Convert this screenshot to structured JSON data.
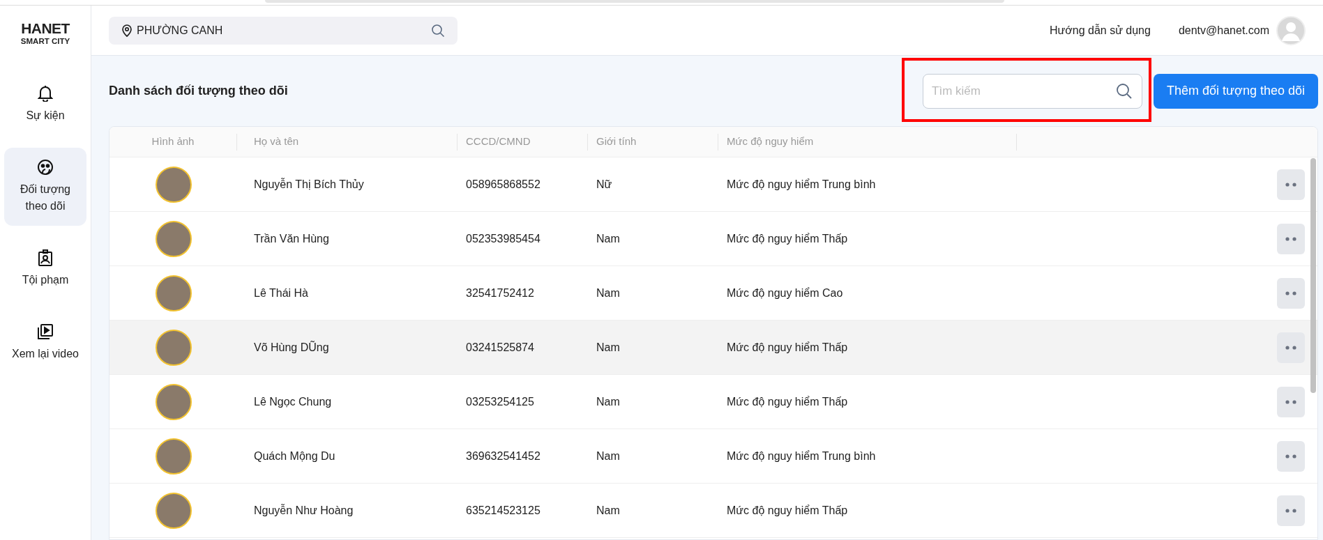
{
  "logo": {
    "brand": "HANET",
    "tagline": "SMART CITY"
  },
  "sidebar": {
    "items": [
      {
        "label": "Sự kiện",
        "selected": false
      },
      {
        "label": "Đối tượng theo dõi",
        "selected": true
      },
      {
        "label": "Tội phạm",
        "selected": false
      },
      {
        "label": "Xem lại video",
        "selected": false
      }
    ]
  },
  "header": {
    "location": "PHƯỜNG CANH",
    "help_link": "Hướng dẫn sử dụng",
    "user_email": "dentv@hanet.com"
  },
  "page": {
    "title": "Danh sách đối tượng theo dõi",
    "search": {
      "placeholder": "Tìm kiếm",
      "highlighted": true
    },
    "add_button": "Thêm đối tượng theo dõi"
  },
  "table": {
    "columns": [
      "Hình ảnh",
      "Họ và tên",
      "CCCD/CMND",
      "Giới tính",
      "Mức độ nguy hiểm"
    ],
    "rows": [
      {
        "name": "Nguyễn Thị Bích Thủy",
        "id": "058965868552",
        "gender": "Nữ",
        "danger": "Mức độ nguy hiểm Trung bình",
        "hovered": false
      },
      {
        "name": "Trần Văn Hùng",
        "id": "052353985454",
        "gender": "Nam",
        "danger": "Mức độ nguy hiểm Thấp",
        "hovered": false
      },
      {
        "name": "Lê Thái Hà",
        "id": "32541752412",
        "gender": "Nam",
        "danger": "Mức độ nguy hiểm Cao",
        "hovered": false
      },
      {
        "name": "Võ Hùng DŨng",
        "id": "03241525874",
        "gender": "Nam",
        "danger": "Mức độ nguy hiểm Thấp",
        "hovered": true
      },
      {
        "name": "Lê Ngọc Chung",
        "id": "03253254125",
        "gender": "Nam",
        "danger": "Mức độ nguy hiểm Thấp",
        "hovered": false
      },
      {
        "name": "Quách Mộng Du",
        "id": "369632541452",
        "gender": "Nam",
        "danger": "Mức độ nguy hiểm Trung bình",
        "hovered": false
      },
      {
        "name": "Nguyễn Như Hoàng",
        "id": "635214523125",
        "gender": "Nam",
        "danger": "Mức độ nguy hiểm Thấp",
        "hovered": false
      }
    ]
  }
}
